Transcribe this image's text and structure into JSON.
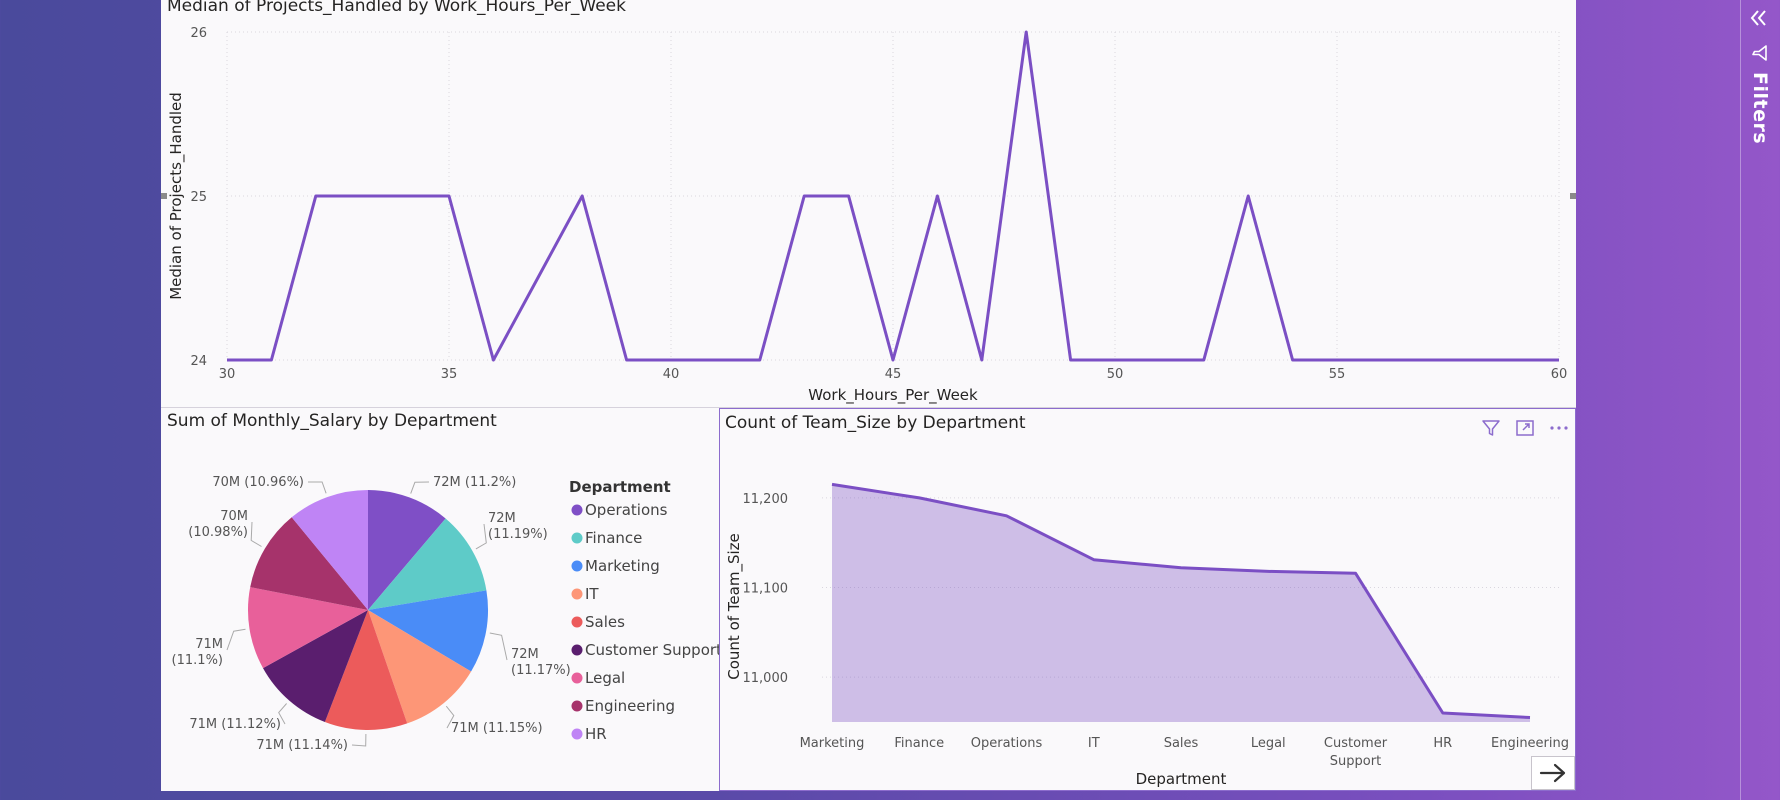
{
  "filters_pane": {
    "label": "Filters",
    "collapse_icon": "chevron-double-left-icon",
    "funnel_icon": "funnel-icon"
  },
  "visuals": {
    "line": {
      "title": "Median of Projects_Handled by Work_Hours_Per_Week"
    },
    "pie": {
      "title": "Sum of Monthly_Salary by Department",
      "legend_title": "Department"
    },
    "area": {
      "title": "Count of Team_Size by Department",
      "header_icons": [
        "funnel-icon",
        "focus-mode-icon",
        "more-options-icon"
      ]
    }
  },
  "navigation": {
    "icon": "arrow-right-icon"
  },
  "accent_color": "#7b4fc4",
  "chart_data": [
    {
      "type": "line",
      "title": "Median of Projects_Handled by Work_Hours_Per_Week",
      "xlabel": "Work_Hours_Per_Week",
      "ylabel": "Median of Projects_Handled",
      "x": [
        30,
        31,
        32,
        33,
        34,
        35,
        36,
        37,
        38,
        39,
        40,
        41,
        42,
        43,
        44,
        45,
        46,
        47,
        48,
        49,
        50,
        51,
        52,
        53,
        54,
        55,
        56,
        57,
        58,
        59,
        60
      ],
      "y": [
        24,
        24,
        25,
        25,
        25,
        25,
        24,
        24.5,
        25,
        24,
        24,
        24,
        24,
        25,
        25,
        24,
        25,
        24,
        26,
        24,
        24,
        24,
        24,
        25,
        24,
        24,
        24,
        24,
        24,
        24,
        24
      ],
      "xlim": [
        30,
        60
      ],
      "ylim": [
        24,
        26
      ],
      "x_ticks": [
        "30",
        "35",
        "40",
        "45",
        "50",
        "55",
        "60"
      ],
      "y_ticks": [
        "24",
        "25",
        "26"
      ],
      "color": "#7b4fc4",
      "grid": true
    },
    {
      "type": "pie",
      "title": "Sum of Monthly_Salary by Department",
      "legend_title": "Department",
      "legend_position": "right",
      "categories": [
        "Operations",
        "Finance",
        "Marketing",
        "IT",
        "Sales",
        "Customer Support",
        "Legal",
        "Engineering",
        "HR"
      ],
      "values": [
        11.2,
        11.19,
        11.17,
        11.15,
        11.14,
        11.12,
        11.1,
        10.98,
        10.96
      ],
      "labels": [
        "72M (11.2%)",
        "72M (11.19%)",
        "72M (11.17%)",
        "71M (11.15%)",
        "71M (11.14%)",
        "71M (11.12%)",
        "71M (11.1%)",
        "70M (10.98%)",
        "70M (10.96%)"
      ],
      "colors": [
        "#7f4fc6",
        "#5ecbc8",
        "#4a8cf7",
        "#fd9677",
        "#ec5b5b",
        "#5a1e6e",
        "#e8609a",
        "#a6336b",
        "#bf84f5"
      ]
    },
    {
      "type": "area",
      "title": "Count of Team_Size by Department",
      "xlabel": "Department",
      "ylabel": "Count of Team_Size",
      "categories": [
        "Marketing",
        "Finance",
        "Operations",
        "IT",
        "Sales",
        "Legal",
        "Customer Support",
        "HR",
        "Engineering"
      ],
      "values": [
        11215,
        11200,
        11180,
        11131,
        11122,
        11118,
        11116,
        10960,
        10955
      ],
      "ylim": [
        10950,
        11230
      ],
      "y_ticks": [
        "11,000",
        "11,100",
        "11,200"
      ],
      "color": "#7b4fc4",
      "grid": true
    }
  ]
}
